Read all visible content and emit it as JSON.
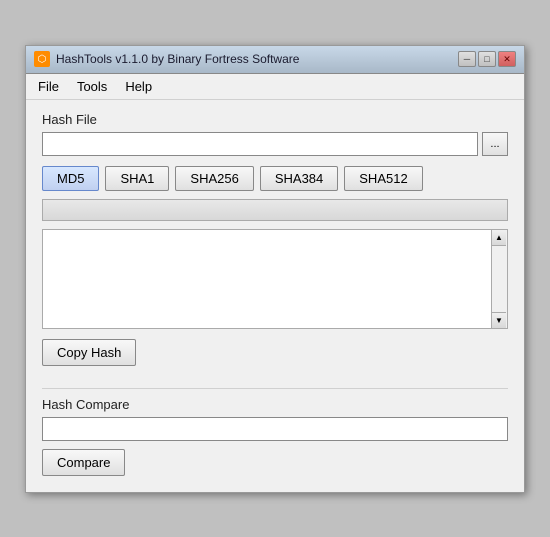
{
  "window": {
    "title": "HashTools v1.1.0 by Binary Fortress Software",
    "icon": "♦"
  },
  "titlebar_buttons": {
    "minimize": "─",
    "maximize": "□",
    "close": "✕"
  },
  "menu": {
    "items": [
      {
        "label": "File"
      },
      {
        "label": "Tools"
      },
      {
        "label": "Help"
      }
    ]
  },
  "hash_file": {
    "label": "Hash File",
    "input_value": "",
    "input_placeholder": "",
    "browse_label": "..."
  },
  "hash_buttons": [
    {
      "label": "MD5",
      "active": true
    },
    {
      "label": "SHA1",
      "active": false
    },
    {
      "label": "SHA256",
      "active": false
    },
    {
      "label": "SHA384",
      "active": false
    },
    {
      "label": "SHA512",
      "active": false
    }
  ],
  "progress": {
    "value": 0
  },
  "hash_output": {
    "value": ""
  },
  "copy_hash": {
    "label": "Copy Hash"
  },
  "hash_compare": {
    "label": "Hash Compare",
    "input_value": "",
    "input_placeholder": ""
  },
  "compare": {
    "label": "Compare"
  }
}
